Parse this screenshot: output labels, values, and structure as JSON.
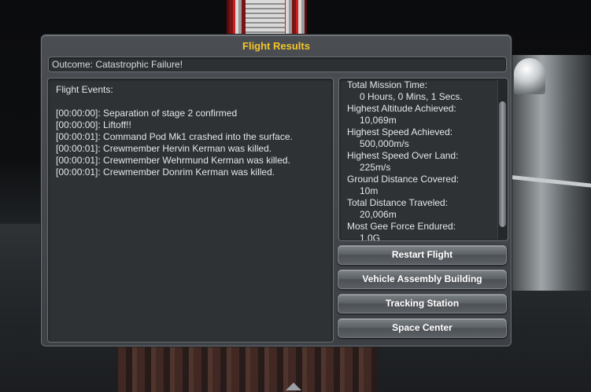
{
  "dialog": {
    "title": "Flight Results",
    "outcome": "Outcome: Catastrophic Failure!"
  },
  "events": {
    "title": "Flight Events:",
    "lines": [
      "[00:00:00]: Separation of stage 2 confirmed",
      "[00:00:00]: Liftoff!!",
      "[00:00:01]: Command Pod Mk1 crashed into the surface.",
      "[00:00:01]: Crewmember Hervin Kerman was killed.",
      "[00:00:01]: Crewmember Wehrmund Kerman was killed.",
      "[00:00:01]: Crewmember Donrim Kerman was killed."
    ]
  },
  "stats": [
    {
      "label": "Total Mission Time:",
      "value": "0 Hours, 0 Mins, 1 Secs."
    },
    {
      "label": "Highest Altitude Achieved:",
      "value": "10,069m"
    },
    {
      "label": "Highest Speed Achieved:",
      "value": "500,000m/s"
    },
    {
      "label": "Highest Speed Over Land:",
      "value": "225m/s"
    },
    {
      "label": "Ground Distance Covered:",
      "value": "10m"
    },
    {
      "label": "Total Distance Traveled:",
      "value": "20,006m"
    },
    {
      "label": "Most Gee Force Endured:",
      "value": "1.0G"
    }
  ],
  "buttons": {
    "restart": "Restart Flight",
    "vab": "Vehicle Assembly Building",
    "tracking": "Tracking Station",
    "space_center": "Space Center"
  },
  "colors": {
    "title_accent": "#f2c62a"
  }
}
